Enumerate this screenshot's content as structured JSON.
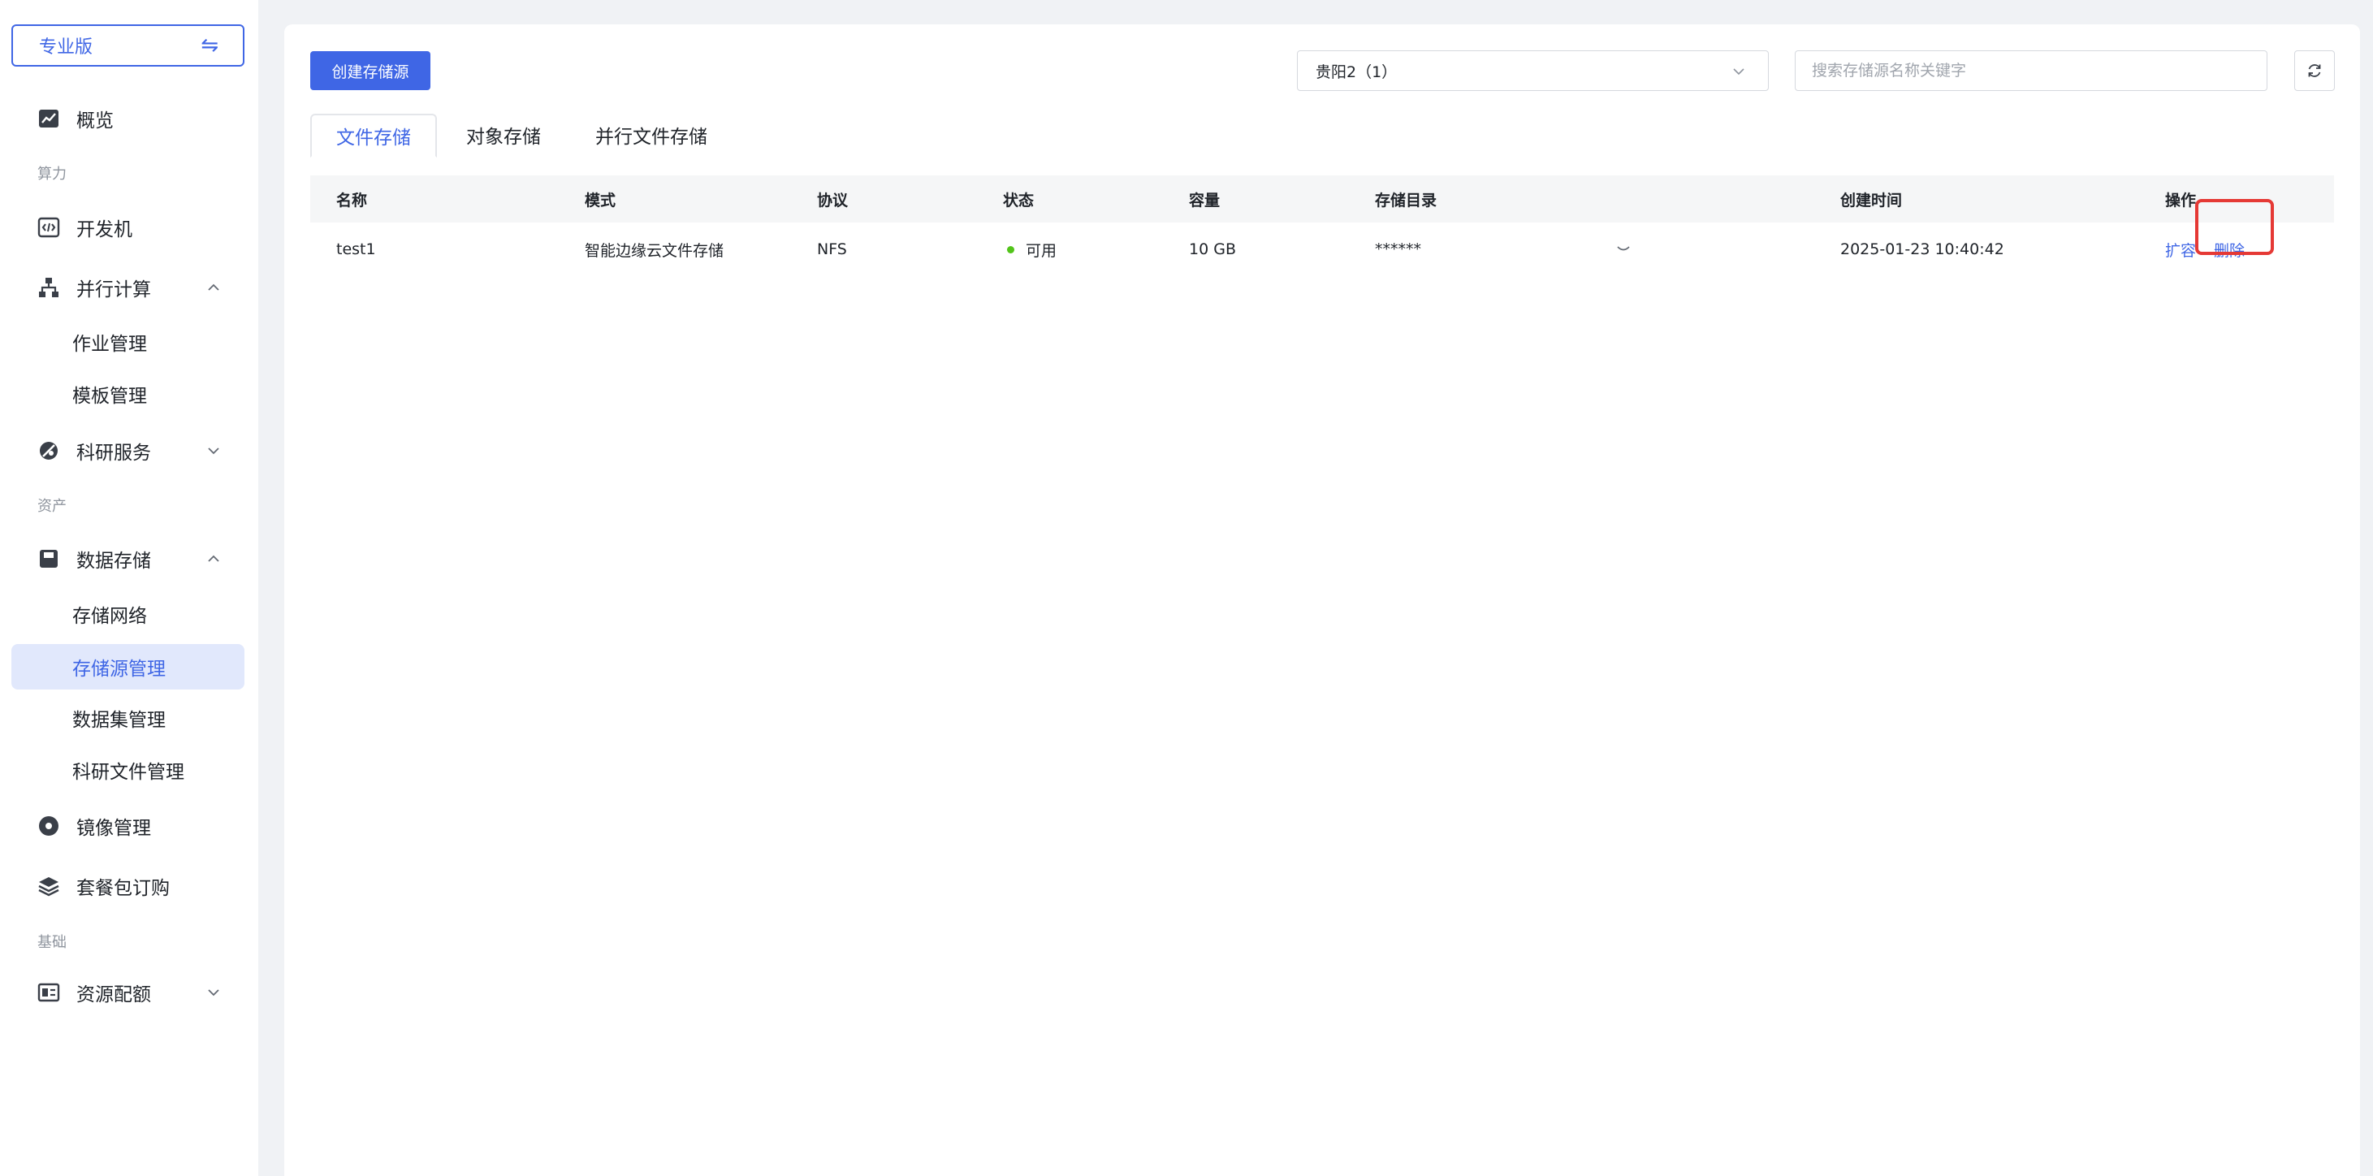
{
  "sidebar": {
    "edition_label": "专业版",
    "edition_switch_icon": "swap-icon",
    "items": {
      "overview": "概览",
      "group_compute": "算力",
      "devbox": "开发机",
      "parallel": "并行计算",
      "job_mgmt": "作业管理",
      "template_mgmt": "模板管理",
      "research": "科研服务",
      "group_assets": "资产",
      "storage": "数据存储",
      "storage_network": "存储网络",
      "storage_source": "存储源管理",
      "dataset": "数据集管理",
      "research_files": "科研文件管理",
      "image_mgmt": "镜像管理",
      "package": "套餐包订购",
      "group_basic": "基础",
      "quota": "资源配额"
    }
  },
  "toolbar": {
    "create_label": "创建存储源",
    "region_value": "贵阳2（1）",
    "search_placeholder": "搜索存储源名称关键字"
  },
  "tabs": [
    "文件存储",
    "对象存储",
    "并行文件存储"
  ],
  "table": {
    "headers": [
      "名称",
      "模式",
      "协议",
      "状态",
      "容量",
      "存储目录",
      "创建时间",
      "操作"
    ],
    "rows": [
      {
        "name": "test1",
        "mode": "智能边缘云文件存储",
        "protocol": "NFS",
        "status": "可用",
        "capacity": "10 GB",
        "directory": "******",
        "created": "2025-01-23 10:40:42",
        "action_expand": "扩容",
        "action_delete": "删除"
      }
    ]
  },
  "colors": {
    "accent": "#3f66e5",
    "status_ok": "#52c41a",
    "highlight": "#e53935"
  }
}
